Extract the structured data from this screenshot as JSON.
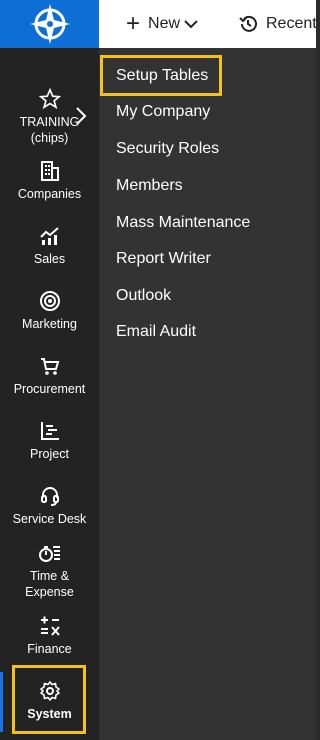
{
  "topbar": {
    "new_label": "New",
    "recent_label": "Recent"
  },
  "sidenav": {
    "items": [
      {
        "label": "TRAINING (chips)",
        "icon": "star-icon"
      },
      {
        "label": "Companies",
        "icon": "building-icon"
      },
      {
        "label": "Sales",
        "icon": "chart-icon"
      },
      {
        "label": "Marketing",
        "icon": "target-icon"
      },
      {
        "label": "Procurement",
        "icon": "cart-icon"
      },
      {
        "label": "Project",
        "icon": "project-icon"
      },
      {
        "label": "Service Desk",
        "icon": "headset-icon"
      },
      {
        "label": "Time & Expense",
        "icon": "stopwatch-icon"
      },
      {
        "label": "Finance",
        "icon": "calculator-icon"
      },
      {
        "label": "System",
        "icon": "gear-icon"
      }
    ],
    "highlight_color": "#f5c21b",
    "active_color": "#1a73e8"
  },
  "flyout": {
    "items": [
      {
        "label": "Setup Tables"
      },
      {
        "label": "My Company"
      },
      {
        "label": "Security Roles"
      },
      {
        "label": "Members"
      },
      {
        "label": "Mass Maintenance"
      },
      {
        "label": "Report Writer"
      },
      {
        "label": "Outlook"
      },
      {
        "label": "Email Audit"
      }
    ]
  }
}
